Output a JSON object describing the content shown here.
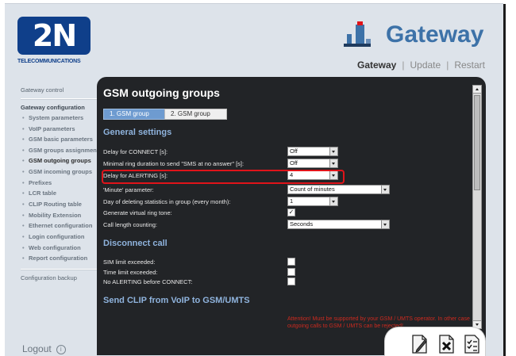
{
  "brand": {
    "logo_text": "2N",
    "logo_sub": "TELECOMMUNICATIONS",
    "product": "Gateway"
  },
  "topnav": [
    "Gateway",
    "Update",
    "Restart"
  ],
  "topnav_sep": "|",
  "sidebar": {
    "control": "Gateway control",
    "config_head": "Gateway configuration",
    "items": [
      "System parameters",
      "VoIP parameters",
      "GSM basic parameters",
      "GSM groups assignment",
      "GSM outgoing groups",
      "GSM incoming groups",
      "Prefixes",
      "LCR table",
      "CLIP Routing table",
      "Mobility Extension",
      "Ethernet configuration",
      "Login configuration",
      "Web configuration",
      "Report configuration"
    ],
    "active_item": "GSM outgoing groups",
    "backup": "Configuration backup",
    "logout": "Logout"
  },
  "panel": {
    "title": "GSM outgoing groups",
    "tabs": [
      "1. GSM group",
      "2. GSM group"
    ],
    "general_title": "General settings",
    "general": {
      "delay_connect": {
        "label": "Delay for CONNECT [s]:",
        "value": "Off"
      },
      "min_ring": {
        "label": "Minimal ring duration to send \"SMS at no answer\" [s]:",
        "value": "Off"
      },
      "delay_alerting": {
        "label": "Delay for ALERTING [s]:",
        "value": "4"
      },
      "minute_param": {
        "label": "'Minute' parameter:",
        "value": "Count of minutes"
      },
      "day_delete": {
        "label": "Day of deleting statistics in group (every month):",
        "value": "1"
      },
      "virtual_ring": {
        "label": "Generate virtual ring tone:",
        "checked": "✓"
      },
      "call_length": {
        "label": "Call length counting:",
        "value": "Seconds"
      }
    },
    "disconnect_title": "Disconnect call",
    "disconnect": {
      "sim_limit": "SIM limit exceeded:",
      "time_limit": "Time limit exceeded:",
      "no_alerting": "No ALERTING before CONNECT:"
    },
    "clip_title": "Send CLIP from VoIP to GSM/UMTS",
    "warning": "Attention! Must be supported by your GSM / UMTS operator. In other case outgoing calls to GSM / UMTS can be rejected!"
  },
  "colors": {
    "highlight": "#e0141a",
    "panel_bg": "#222427",
    "section_title": "#8fb3dd",
    "brand_blue": "#0f3f8a"
  },
  "icons": [
    "info-icon",
    "document-pen-icon",
    "document-delete-icon",
    "checklist-icon",
    "gateway-icon"
  ]
}
